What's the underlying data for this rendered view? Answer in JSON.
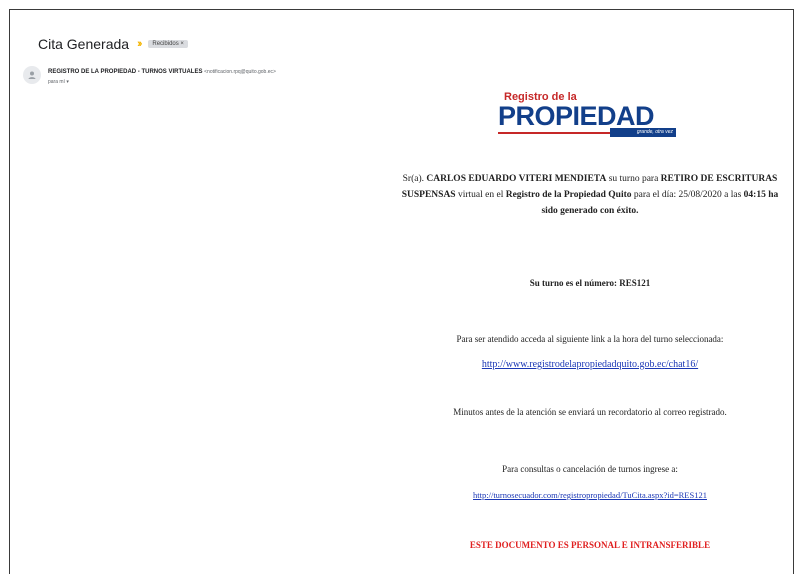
{
  "email": {
    "subject": "Cita Generada",
    "label": "Recibidos ×",
    "sender_name": "REGISTRO DE LA PROPIEDAD - TURNOS VIRTUALES",
    "sender_email": "<notificacion.rpq@quito.gob.ec>",
    "to": "para mí ▾"
  },
  "logo": {
    "top": "Registro de la",
    "main": "PROPIEDAD",
    "slogan": "grande, otra vez"
  },
  "message": {
    "p1": "Sr(a).",
    "name": "CARLOS EDUARDO VITERI MENDIETA",
    "p2": "su turno para",
    "service": "RETIRO DE ESCRITURAS SUSPENSAS",
    "p3": "virtual en el",
    "office": "Registro de la Propiedad Quito",
    "p4": "para el día:",
    "date": "25/08/2020",
    "p5": "a las",
    "time": "04:15",
    "status": "ha sido generado con éxito.",
    "turn": "Su turno es el número: RES121",
    "instructions": "Para ser atendido acceda al siguiente link a la hora del turno seleccionada:",
    "link_chat": "http://www.registrodelapropiedadquito.gob.ec/chat16/",
    "reminder": "Minutos antes de la atención se enviará un recordatorio al correo registrado.",
    "consult": "Para consultas o cancelación de turnos ingrese a:",
    "link_cita": "http://turnosecuador.com/registropropiedad/TuCita.aspx?id=RES121",
    "warning": "ESTE DOCUMENTO ES PERSONAL E INTRANSFERIBLE"
  },
  "icons": {
    "important": "important-marker-icon",
    "avatar": "person-icon"
  },
  "colors": {
    "brand_blue": "#123f8a",
    "brand_red": "#c62828",
    "warning": "#e02020",
    "link": "#1a37b5"
  }
}
